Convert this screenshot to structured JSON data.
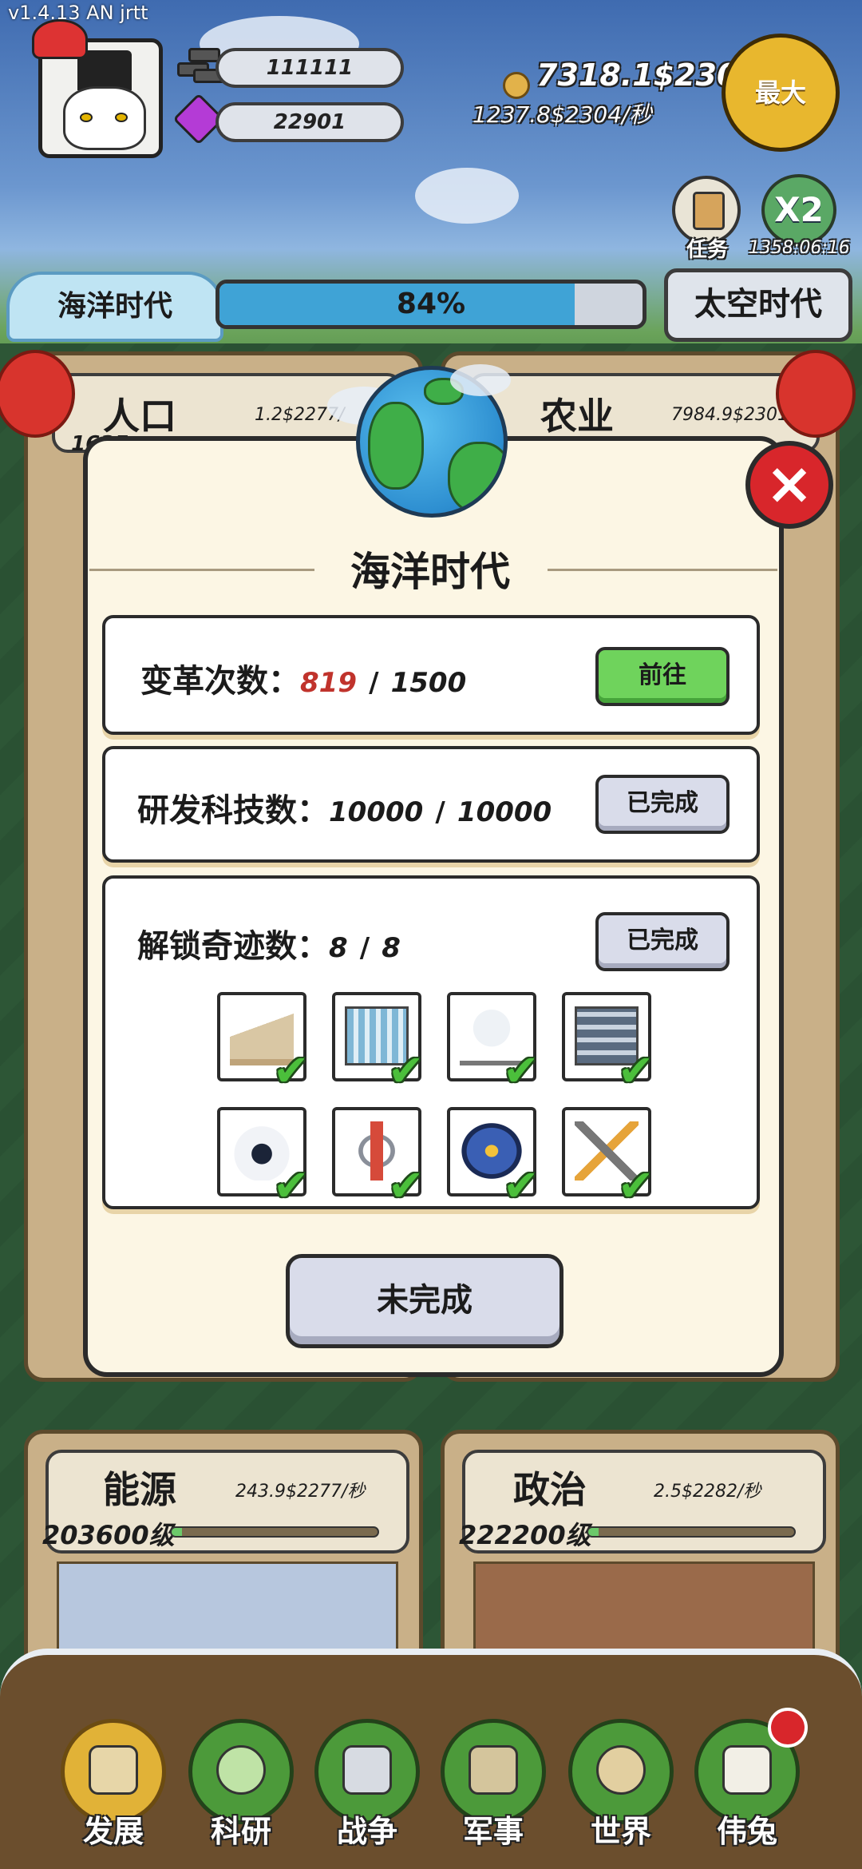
{
  "app": {
    "version": "v1.4.13 AN jrtt"
  },
  "resources": {
    "bars_value": "111111",
    "gems_value": "22901",
    "money_total": "7318.1$2304",
    "money_rate": "1237.8$2304/秒"
  },
  "header": {
    "max_button": "最大",
    "task_label": "任务",
    "x2_label": "X2",
    "timer": "1358:06:16"
  },
  "era": {
    "current": "海洋时代",
    "next": "太空时代",
    "progress_text": "84%",
    "progress_value": 0.84
  },
  "categories": [
    {
      "name": "人口",
      "rate": "1.2$2277/",
      "level": "1635",
      "progress": 0.4
    },
    {
      "name": "农业",
      "rate": "7984.9$2301/",
      "level": "",
      "progress": 0.4
    },
    {
      "name": "能源",
      "rate": "243.9$2277/秒",
      "level": "203600级",
      "progress": 0.05
    },
    {
      "name": "政治",
      "rate": "2.5$2282/秒",
      "level": "222200级",
      "progress": 0.05
    }
  ],
  "modal": {
    "title": "海洋时代",
    "close_icon": "close-icon",
    "requirements": [
      {
        "label": "变革次数：",
        "current": "819",
        "separator": "/",
        "target": "1500",
        "current_color": "#c0332c",
        "button": "前往",
        "state": "go"
      },
      {
        "label": "研发科技数：",
        "current": "10000",
        "separator": "/",
        "target": "10000",
        "current_color": "#1b1b1b",
        "button": "已完成",
        "state": "done"
      },
      {
        "label": "解锁奇迹数：",
        "current": "8",
        "separator": "/",
        "target": "8",
        "current_color": "#1b1b1b",
        "button": "已完成",
        "state": "done"
      }
    ],
    "wonders": [
      {
        "icon": "opera-house-icon",
        "done": true
      },
      {
        "icon": "modern-building-icon",
        "done": true
      },
      {
        "icon": "lunar-lander-icon",
        "done": true
      },
      {
        "icon": "server-building-icon",
        "done": true
      },
      {
        "icon": "robot-icon",
        "done": true
      },
      {
        "icon": "space-station-icon",
        "done": true
      },
      {
        "icon": "ufo-icon",
        "done": true
      },
      {
        "icon": "satellite-icon",
        "done": true
      }
    ],
    "footer_button": "未完成"
  },
  "nav": [
    {
      "label": "发展",
      "icon": "hammer-icon",
      "active": true
    },
    {
      "label": "科研",
      "icon": "flask-icon",
      "active": false
    },
    {
      "label": "战争",
      "icon": "crossed-swords-icon",
      "active": false
    },
    {
      "label": "军事",
      "icon": "military-tent-icon",
      "active": false
    },
    {
      "label": "世界",
      "icon": "globe-icon",
      "active": false
    },
    {
      "label": "伟兔",
      "icon": "rabbit-portrait-icon",
      "active": false,
      "badge": true
    }
  ],
  "colors": {
    "go_button": "#6fd35c",
    "done_button": "#d9dcea",
    "progress_fill": "#3fa3d6",
    "close_button": "#d8262b"
  }
}
